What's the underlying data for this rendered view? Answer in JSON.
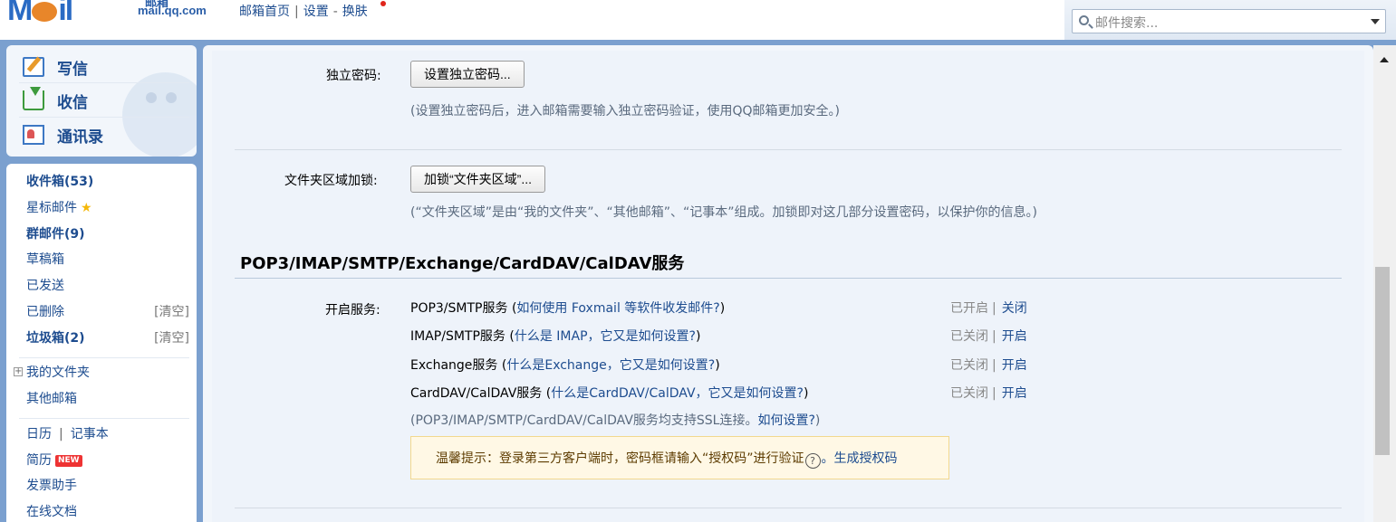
{
  "header": {
    "logo_text": "Mail",
    "logo_subtitle": "邮箱",
    "logo_url": "mail.qq.com",
    "nav": [
      "邮箱首页",
      "设置",
      "换肤"
    ],
    "search_placeholder": "邮件搜索..."
  },
  "sidebar": {
    "quick": [
      {
        "label": "写信",
        "icon": "compose-icon"
      },
      {
        "label": "收信",
        "icon": "inbox-download-icon"
      },
      {
        "label": "通讯录",
        "icon": "contacts-icon"
      }
    ],
    "folders": [
      {
        "label": "收件箱(53)"
      },
      {
        "label": "星标邮件"
      },
      {
        "label": "群邮件(9)"
      },
      {
        "label": "草稿箱"
      },
      {
        "label": "已发送"
      },
      {
        "label": "已删除",
        "action": "[清空]"
      },
      {
        "label": "垃圾箱(2)",
        "action": "[清空]"
      }
    ],
    "my_folders": "我的文件夹",
    "other_mail": "其他邮箱",
    "calendar": "日历",
    "notes": "记事本",
    "resume": "简历",
    "resume_badge": "NEW",
    "invoice": "发票助手",
    "online_docs": "在线文档"
  },
  "main": {
    "independent_password": {
      "label": "独立密码:",
      "button": "设置独立密码...",
      "hint": "(设置独立密码后，进入邮箱需要输入独立密码验证，使用QQ邮箱更加安全。)"
    },
    "folder_lock": {
      "label": "文件夹区域加锁:",
      "button": "加锁“文件夹区域”...",
      "hint": "(“文件夹区域”是由“我的文件夹”、“其他邮箱”、“记事本”组成。加锁即对这几部分设置密码，以保护你的信息。)"
    },
    "section_title": "POP3/IMAP/SMTP/Exchange/CardDAV/CalDAV服务",
    "enable_label": "开启服务:",
    "services": [
      {
        "name": "POP3/SMTP服务",
        "help": "如何使用 Foxmail 等软件收发邮件?",
        "status": "已开启",
        "action": "关闭"
      },
      {
        "name": "IMAP/SMTP服务",
        "help": "什么是 IMAP，它又是如何设置?",
        "status": "已关闭",
        "action": "开启"
      },
      {
        "name": "Exchange服务",
        "help": "什么是Exchange，它又是如何设置?",
        "status": "已关闭",
        "action": "开启"
      },
      {
        "name": "CardDAV/CalDAV服务",
        "help": "什么是CardDAV/CalDAV，它又是如何设置?",
        "status": "已关闭",
        "action": "开启"
      }
    ],
    "ssl_note": "(POP3/IMAP/SMTP/CardDAV/CalDAV服务均支持SSL连接。",
    "ssl_link": "如何设置?",
    "tip_text": "温馨提示：登录第三方客户端时，密码框请输入“授权码”进行验证",
    "tip_q": "?",
    "tip_link": "。生成授权码"
  }
}
